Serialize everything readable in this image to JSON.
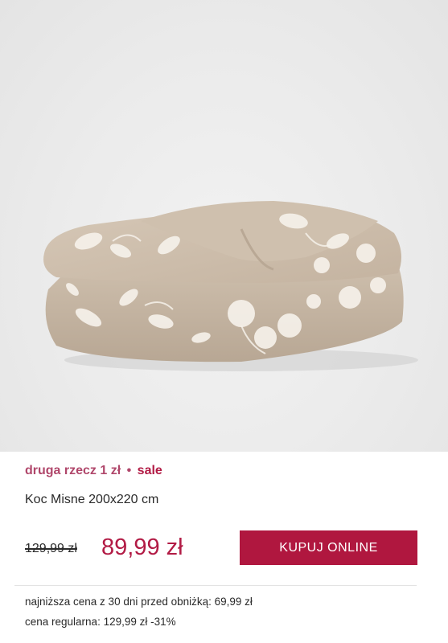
{
  "product": {
    "image_alt": "blanket-photo",
    "promo_text": "druga rzecz 1 zł",
    "promo_separator": "•",
    "promo_sale": "sale",
    "title": "Koc Misne 200x220 cm",
    "old_price": "129,99 zł",
    "new_price": "89,99 zł",
    "buy_label": "KUPUJ ONLINE",
    "lowest_price_note": "najniższa cena z 30 dni przed obniżką: 69,99 zł",
    "regular_price_note": "cena regularna: 129,99 zł -31%"
  },
  "colors": {
    "accent": "#b0173f",
    "promo": "#b0476b",
    "price": "#b21b45",
    "blanket": "#c9b9a7",
    "pattern": "#f6f1ea"
  }
}
